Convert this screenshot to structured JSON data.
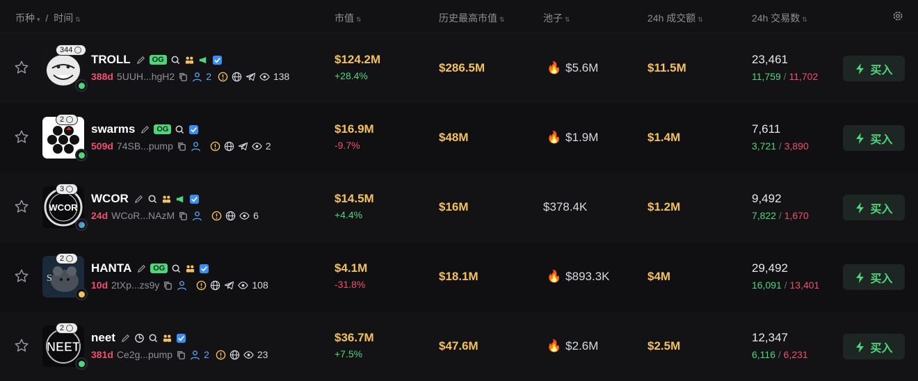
{
  "header": {
    "coin": "币种",
    "sep": "/",
    "time": "时间",
    "mcap": "市值",
    "ath": "历史最高市值",
    "pool": "池子",
    "vol": "24h 成交额",
    "txns": "24h 交易数"
  },
  "colors": {
    "accent_green": "#4ed67e",
    "accent_red": "#f0506e",
    "gold": "#f3c15d",
    "blue": "#5aa8ff"
  },
  "rows": [
    {
      "name": "TROLL",
      "holders": "344",
      "age": "388d",
      "addr": "5UUH...hgH2",
      "users": "2",
      "views": "138",
      "mcap": "$124.2M",
      "change": "+28.4%",
      "ath": "$286.5M",
      "pool": "$5.6M",
      "vol": "$11.5M",
      "txns": "23,461",
      "buys": "11,759",
      "sells": "11,702",
      "buy_label": "买入"
    },
    {
      "name": "swarms",
      "holders": "2",
      "age": "509d",
      "addr": "74SB...pump",
      "views": "2",
      "mcap": "$16.9M",
      "change": "-9.7%",
      "ath": "$48M",
      "pool": "$1.9M",
      "vol": "$1.4M",
      "txns": "7,611",
      "buys": "3,721",
      "sells": "3,890",
      "buy_label": "买入"
    },
    {
      "name": "WCOR",
      "holders": "3",
      "age": "24d",
      "addr": "WCoR...NAzM",
      "views": "6",
      "mcap": "$14.5M",
      "change": "+4.4%",
      "ath": "$16M",
      "pool": "$378.4K",
      "vol": "$1.2M",
      "txns": "9,492",
      "buys": "7,822",
      "sells": "1,670",
      "buy_label": "买入"
    },
    {
      "name": "HANTA",
      "holders": "2",
      "age": "10d",
      "addr": "2tXp...zs9y",
      "views": "108",
      "mcap": "$4.1M",
      "change": "-31.8%",
      "ath": "$18.1M",
      "pool": "$893.3K",
      "vol": "$4M",
      "txns": "29,492",
      "buys": "16,091",
      "sells": "13,401",
      "buy_label": "买入"
    },
    {
      "name": "neet",
      "holders": "2",
      "age": "381d",
      "addr": "Ce2g...pump",
      "users": "2",
      "views": "23",
      "mcap": "$36.7M",
      "change": "+7.5%",
      "ath": "$47.6M",
      "pool": "$2.6M",
      "vol": "$2.5M",
      "txns": "12,347",
      "buys": "6,116",
      "sells": "6,231",
      "buy_label": "买入"
    }
  ]
}
